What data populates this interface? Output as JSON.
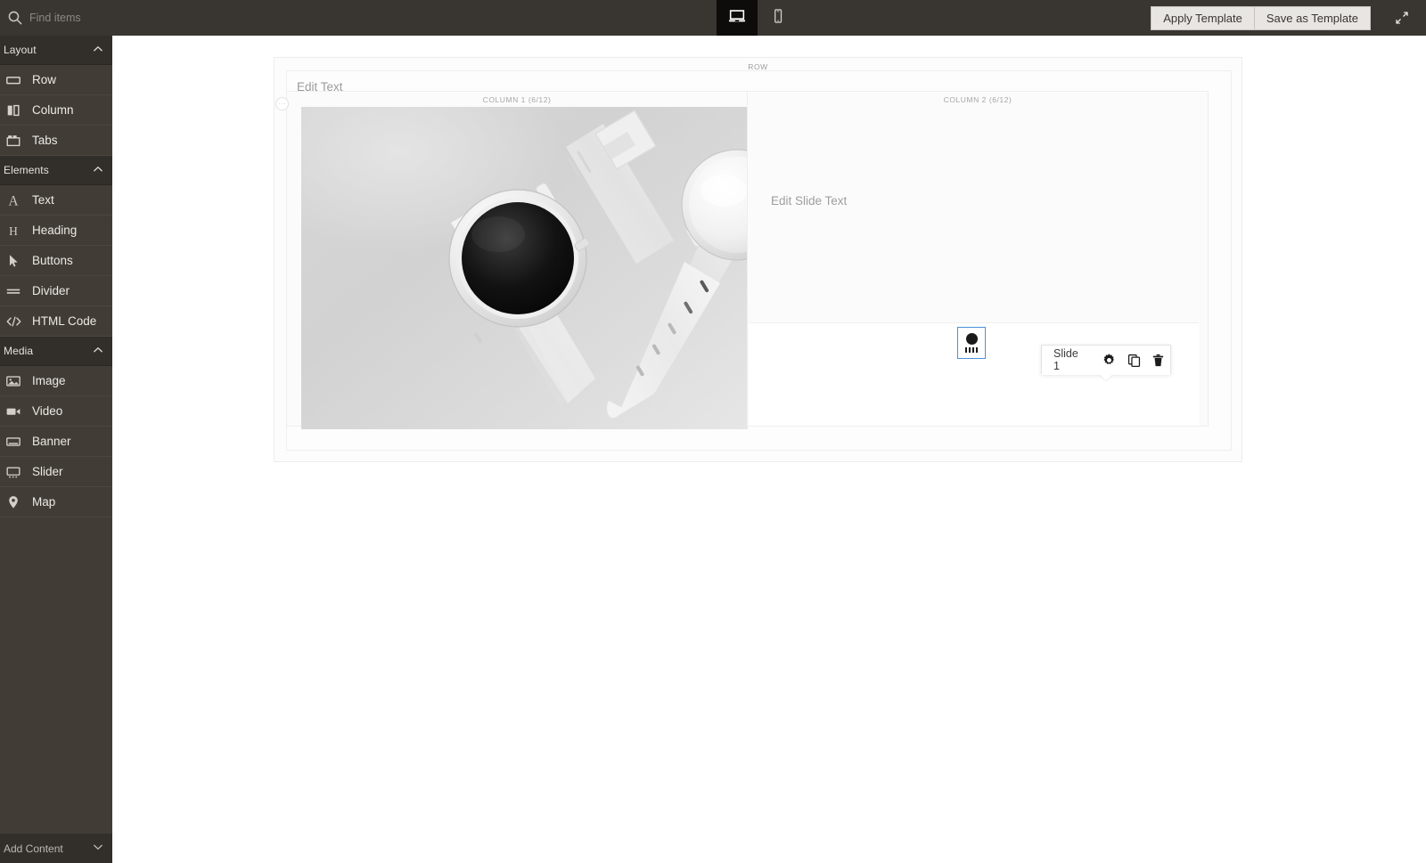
{
  "topbar": {
    "search": {
      "placeholder": "Find items",
      "value": "",
      "icon": "search-icon"
    },
    "devices": [
      {
        "name": "desktop",
        "icon": "desktop-icon",
        "active": true
      },
      {
        "name": "mobile",
        "icon": "mobile-icon",
        "active": false
      }
    ],
    "apply_template_label": "Apply Template",
    "save_template_label": "Save as Template",
    "expand_icon": "expand-diagonal-icon"
  },
  "sidebar": {
    "groups": [
      {
        "label": "Layout",
        "chevron": "chevron-up-icon",
        "items": [
          {
            "label": "Row",
            "icon": "row-icon"
          },
          {
            "label": "Column",
            "icon": "column-icon"
          },
          {
            "label": "Tabs",
            "icon": "tabs-icon"
          }
        ]
      },
      {
        "label": "Elements",
        "chevron": "chevron-up-icon",
        "items": [
          {
            "label": "Text",
            "icon": "text-a-icon"
          },
          {
            "label": "Heading",
            "icon": "heading-h-icon"
          },
          {
            "label": "Buttons",
            "icon": "cursor-pointer-icon"
          },
          {
            "label": "Divider",
            "icon": "divider-icon"
          },
          {
            "label": "HTML Code",
            "icon": "code-brackets-icon"
          }
        ]
      },
      {
        "label": "Media",
        "chevron": "chevron-up-icon",
        "items": [
          {
            "label": "Image",
            "icon": "image-icon"
          },
          {
            "label": "Video",
            "icon": "video-camera-icon"
          },
          {
            "label": "Banner",
            "icon": "banner-icon"
          },
          {
            "label": "Slider",
            "icon": "slider-icon"
          },
          {
            "label": "Map",
            "icon": "map-pin-icon"
          }
        ]
      }
    ],
    "footer": {
      "label": "Add Content",
      "chevron": "chevron-down-icon"
    }
  },
  "canvas": {
    "row_label": "ROW",
    "edit_text_placeholder": "Edit Text",
    "columns": [
      {
        "label": "COLUMN 1 (6/12)",
        "content": "watch-image"
      },
      {
        "label": "COLUMN 2 (6/12)",
        "content": "slider"
      }
    ],
    "image_handle": "···",
    "slide_text_placeholder": "Edit Slide Text",
    "slide_toolbar": {
      "title": "Slide 1",
      "settings_icon": "gear-icon",
      "duplicate_icon": "copy-icon",
      "delete_icon": "trash-icon"
    },
    "slide_element_icon": "slider-indicator-icon"
  },
  "colors": {
    "sidebar_bg": "#413c36",
    "sidebar_group_bg": "#322e29",
    "topbar_bg": "#393531",
    "device_active_bg": "#0d0c0b",
    "selection_blue": "#4a90d9",
    "button_bg": "#e8e6e3"
  }
}
